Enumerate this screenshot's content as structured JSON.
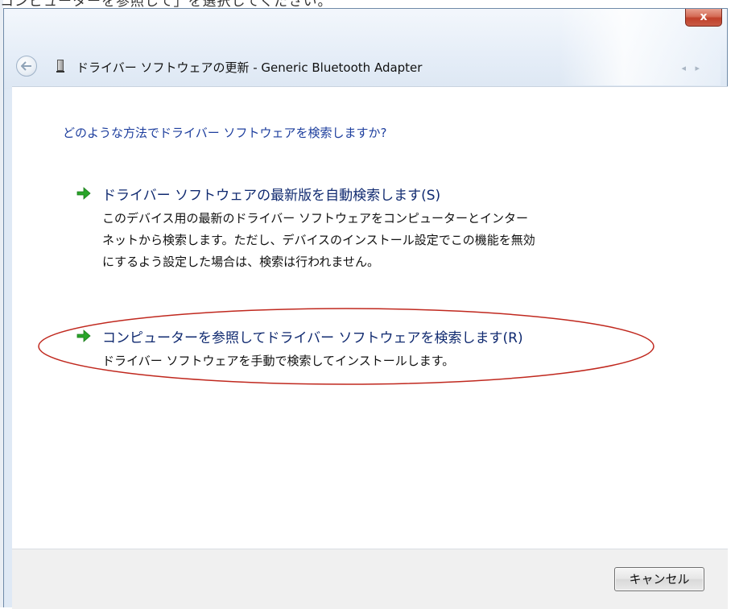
{
  "caption": "コンピューターを参照して」を選択してください。",
  "window": {
    "title": "ドライバー ソフトウェアの更新 - Generic Bluetooth Adapter",
    "close_label": "x"
  },
  "main": {
    "question": "どのような方法でドライバー ソフトウェアを検索しますか?",
    "options": [
      {
        "title": "ドライバー ソフトウェアの最新版を自動検索します(S)",
        "desc_lines": [
          "このデバイス用の最新のドライバー ソフトウェアをコンピューターとインター",
          "ネットから検索します。ただし、デバイスのインストール設定でこの機能を無効",
          "にするよう設定した場合は、検索は行われません。"
        ]
      },
      {
        "title": "コンピューターを参照してドライバー ソフトウェアを検索します(R)",
        "desc_lines": [
          "ドライバー ソフトウェアを手動で検索してインストールします。"
        ]
      }
    ]
  },
  "footer": {
    "cancel_label": "キャンセル"
  },
  "colors": {
    "link_blue": "#1e3f9e",
    "arrow_green": "#2aa52a",
    "highlight_red": "#c0281e"
  }
}
